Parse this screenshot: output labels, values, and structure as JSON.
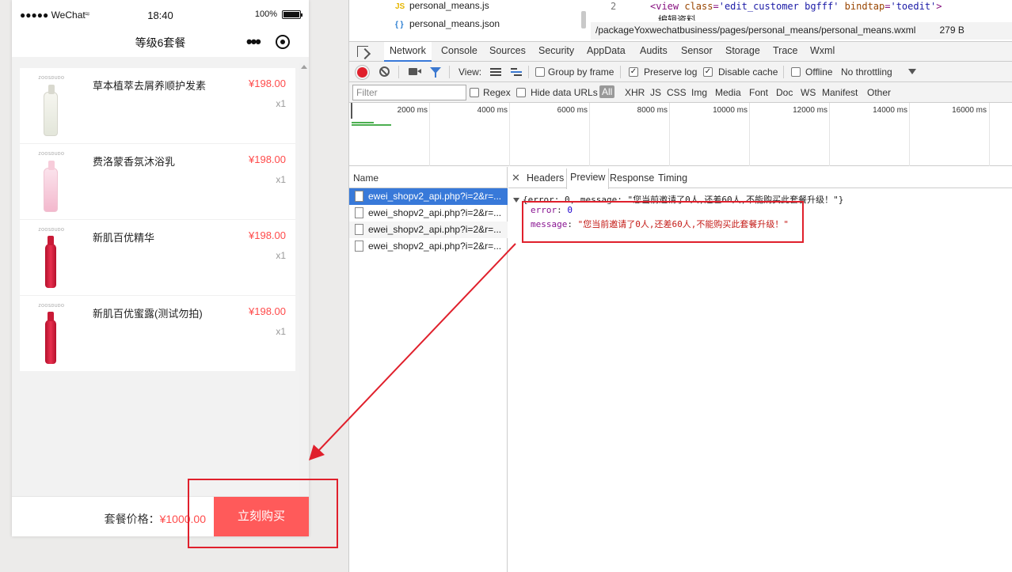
{
  "phone": {
    "status": {
      "carrier": "●●●●● WeChat",
      "wifi_icon": "wifi-icon",
      "time": "18:40",
      "battery": "100%"
    },
    "nav": {
      "title": "等级6套餐",
      "more_icon": "more-dots-icon",
      "close_icon": "target-close-icon"
    },
    "products": [
      {
        "brand": "ZOOSDUDO",
        "name": "草本植萃去屑养顺护发素",
        "price": "¥198.00",
        "qty": "x1",
        "image": "shampoo-bottle"
      },
      {
        "brand": "ZOOSDUDO",
        "name": "费洛蒙香氛沐浴乳",
        "price": "¥198.00",
        "qty": "x1",
        "image": "body-wash-bottle"
      },
      {
        "brand": "ZOOSDUDO",
        "name": "新肌百优精华",
        "price": "¥198.00",
        "qty": "x1",
        "image": "essence-bottle"
      },
      {
        "brand": "ZOOSDUDO",
        "name": "新肌百优蜜露(测试勿拍)",
        "price": "¥198.00",
        "qty": "x1",
        "image": "lotion-bottle"
      }
    ],
    "bottom": {
      "price_label": "套餐价格：",
      "price_value": "¥1000.00",
      "buy_label": "立刻购买"
    }
  },
  "devtools": {
    "files": [
      {
        "icon": "JS",
        "name": "personal_means.js"
      },
      {
        "icon": "{ }",
        "name": "personal_means.json"
      }
    ],
    "code": {
      "line_numbers": [
        "2"
      ],
      "line": {
        "tag_open": "<view ",
        "attr1": "class",
        "val1": "'edit_customer bgfff'",
        "attr2": "bindtap",
        "val2": "'toedit'",
        "tag_close": ">"
      },
      "line2": "编辑资料"
    },
    "path": "/packageYoxwechatbusiness/pages/personal_means/personal_means.wxml",
    "path_size": "279 B",
    "tabs": [
      "Network",
      "Console",
      "Sources",
      "Security",
      "AppData",
      "Audits",
      "Sensor",
      "Storage",
      "Trace",
      "Wxml"
    ],
    "active_tab": "Network",
    "toolbar": {
      "view_label": "View:",
      "group_by_frame": "Group by frame",
      "preserve_log": "Preserve log",
      "disable_cache": "Disable cache",
      "offline": "Offline",
      "throttling": "No throttling",
      "preserve_log_checked": true,
      "disable_cache_checked": true
    },
    "filter": {
      "placeholder": "Filter",
      "regex": "Regex",
      "hide_data_urls": "Hide data URLs",
      "types": [
        "All",
        "XHR",
        "JS",
        "CSS",
        "Img",
        "Media",
        "Font",
        "Doc",
        "WS",
        "Manifest",
        "Other"
      ]
    },
    "timeline_labels": [
      "2000 ms",
      "4000 ms",
      "6000 ms",
      "8000 ms",
      "10000 ms",
      "12000 ms",
      "14000 ms",
      "16000 ms"
    ],
    "requests": {
      "header": "Name",
      "items": [
        "ewei_shopv2_api.php?i=2&r=...",
        "ewei_shopv2_api.php?i=2&r=...",
        "ewei_shopv2_api.php?i=2&r=...",
        "ewei_shopv2_api.php?i=2&r=..."
      ]
    },
    "detail": {
      "tabs": [
        "Headers",
        "Preview",
        "Response",
        "Timing"
      ],
      "active_tab": "Preview",
      "summary": "{error: 0, message: \"您当前邀请了0人,还差60人,不能购买此套餐升级！\"}",
      "error_key": "error",
      "error_value": "0",
      "message_key": "message",
      "message_value": "\"您当前邀请了0人,还差60人,不能购买此套餐升级！\""
    }
  },
  "colors": {
    "price_red": "#ff4b4b",
    "buy_button": "#ff5a5a",
    "annotation": "#e0202c",
    "devtools_active": "#3879d9"
  }
}
